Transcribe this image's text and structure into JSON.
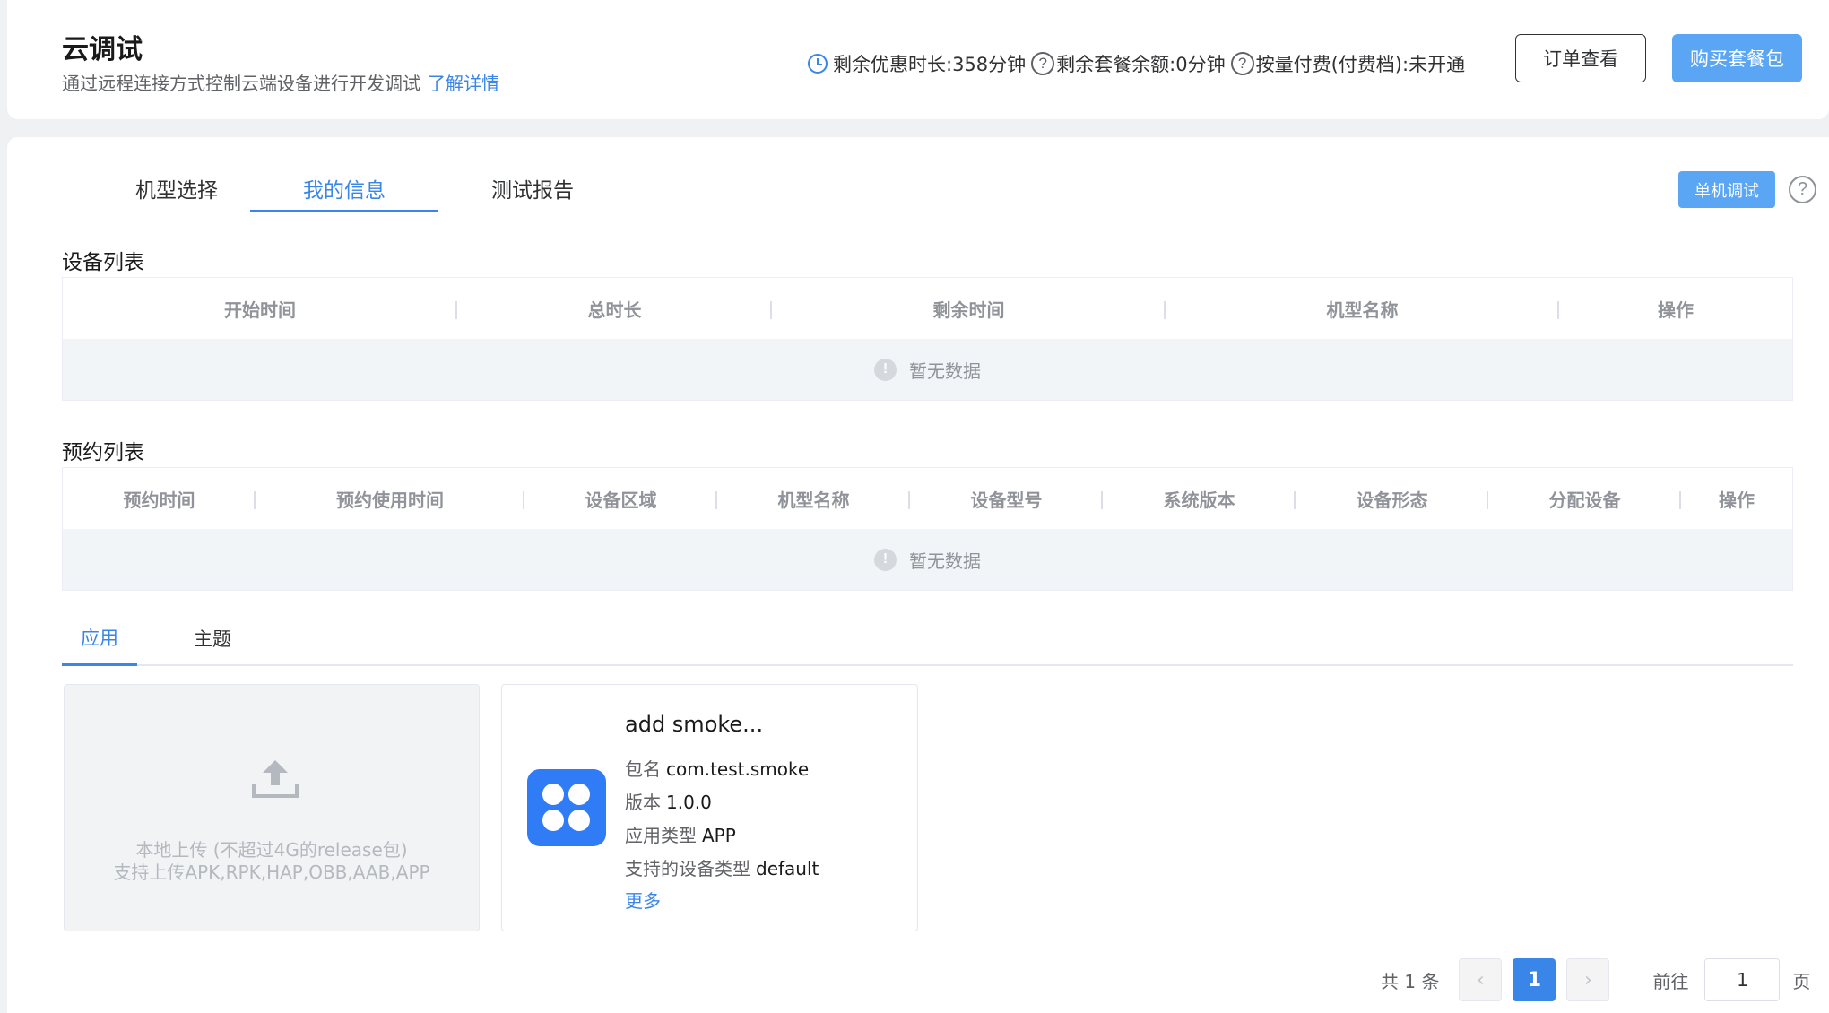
{
  "header": {
    "title": "云调试",
    "subtitle": "通过远程连接方式控制云端设备进行开发调试",
    "learn_more": "了解详情",
    "quota_discount": "剩余优惠时长:358分钟",
    "quota_package": "剩余套餐余额:0分钟",
    "quota_payg": "按量付费(付费档):未开通",
    "order_button": "订单查看",
    "buy_button": "购买套餐包"
  },
  "tabs": [
    {
      "label": "机型选择",
      "active": false
    },
    {
      "label": "我的信息",
      "active": true
    },
    {
      "label": "测试报告",
      "active": false
    }
  ],
  "single_debug_button": "单机调试",
  "device_list": {
    "title": "设备列表",
    "columns": [
      "开始时间",
      "总时长",
      "剩余时间",
      "机型名称",
      "操作"
    ],
    "empty_text": "暂无数据"
  },
  "reservation_list": {
    "title": "预约列表",
    "columns": [
      "预约时间",
      "预约使用时间",
      "设备区域",
      "机型名称",
      "设备型号",
      "系统版本",
      "设备形态",
      "分配设备",
      "操作"
    ],
    "empty_text": "暂无数据"
  },
  "subtabs": [
    {
      "label": "应用",
      "active": true
    },
    {
      "label": "主题",
      "active": false
    }
  ],
  "upload": {
    "line1": "本地上传 (不超过4G的release包)",
    "line2": "支持上传APK,RPK,HAP,OBB,AAB,APP"
  },
  "app": {
    "name": "add  smoke...",
    "package_label": "包名",
    "package_value": "com.test.smoke",
    "version_label": "版本",
    "version_value": "1.0.0",
    "type_label": "应用类型",
    "type_value": "APP",
    "device_label": "支持的设备类型",
    "device_value": "default",
    "more": "更多"
  },
  "pagination": {
    "total_text": "共 1 条",
    "current_page": "1",
    "goto_label": "前往",
    "goto_value": "1",
    "suffix": "页"
  },
  "colors": {
    "accent": "#3a86e8",
    "primary_button": "#5aa6f4",
    "app_icon": "#2f7cf6"
  }
}
